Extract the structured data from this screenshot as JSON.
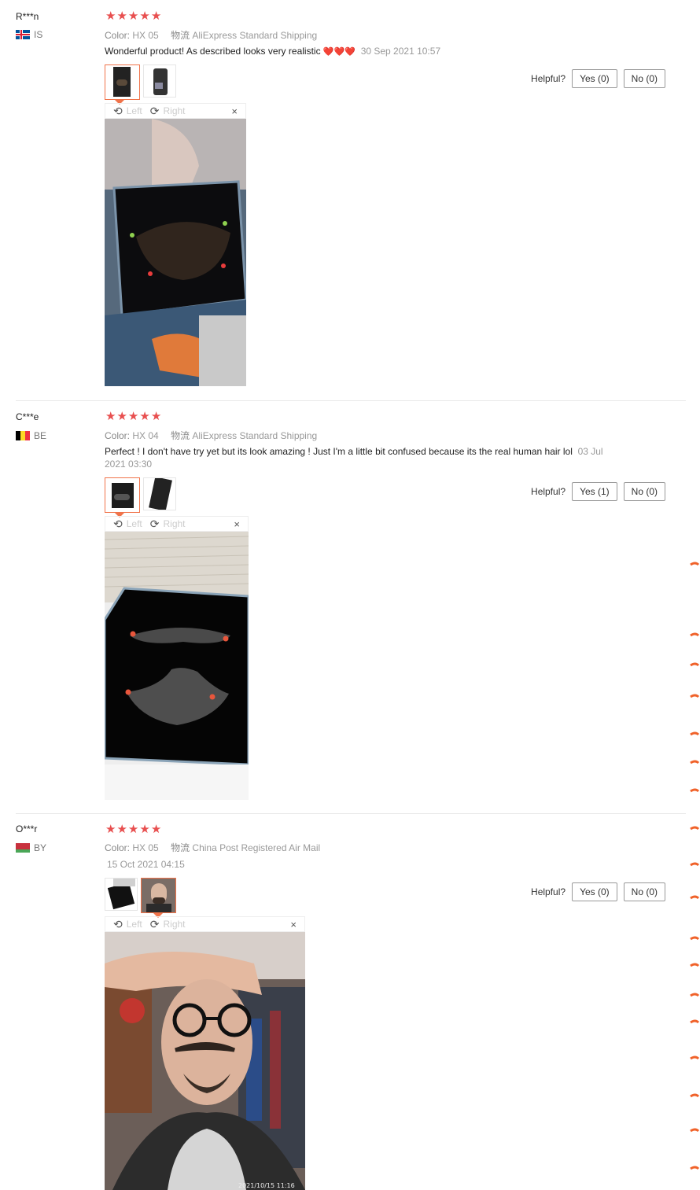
{
  "reviews": [
    {
      "user": "R***n",
      "country": "IS",
      "color_key": "Color:",
      "color_value": "HX 05",
      "logistics_key": "物流",
      "logistics_value": "AliExpress Standard Shipping",
      "text": "Wonderful product! As described looks very realistic",
      "emoji": "❤️❤️❤️",
      "date": "30 Sep 2021 10:57",
      "helpful_label": "Helpful?",
      "yes_label": "Yes (0)",
      "no_label": "No (0)"
    },
    {
      "user": "C***e",
      "country": "BE",
      "color_key": "Color:",
      "color_value": "HX 04",
      "logistics_key": "物流",
      "logistics_value": "AliExpress Standard Shipping",
      "text": "Perfect ! I don't have try yet but its look amazing ! Just I'm a little bit confused because its the real human hair lol",
      "date": "03 Jul 2021 03:30",
      "helpful_label": "Helpful?",
      "yes_label": "Yes (1)",
      "no_label": "No (0)"
    },
    {
      "user": "O***r",
      "country": "BY",
      "color_key": "Color:",
      "color_value": "HX 05",
      "logistics_key": "物流",
      "logistics_value": "China Post Registered Air Mail",
      "text": "",
      "date": "15 Oct 2021 04:15",
      "helpful_label": "Helpful?",
      "yes_label": "Yes (0)",
      "no_label": "No (0)",
      "photo_timestamp": "2021/10/15 11:16"
    }
  ],
  "viewer": {
    "rotate_left": "Left",
    "rotate_right": "Right",
    "close": "×"
  },
  "rating_stars": 5,
  "colors": {
    "star": "#e84f4f",
    "accent": "#f0734a"
  }
}
